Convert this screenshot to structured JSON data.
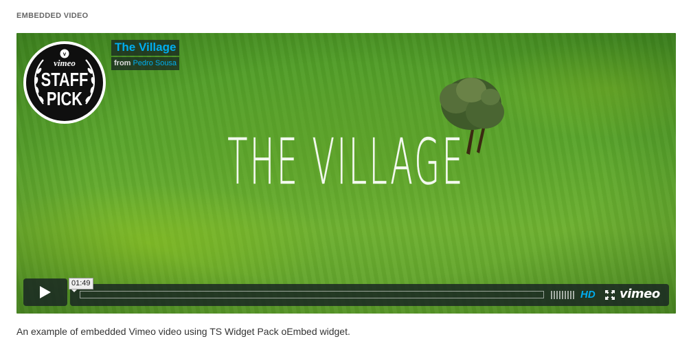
{
  "section": {
    "label": "EMBEDDED VIDEO"
  },
  "badge": {
    "brand": "vimeo",
    "line1": "STAFF",
    "line2": "PICK"
  },
  "video": {
    "title": "The Village",
    "from_label": "from",
    "author": "Pedro Sousa",
    "overlay_text": "THE VILLAGE"
  },
  "controls": {
    "time_tooltip": "01:49",
    "hd_label": "HD",
    "logo_text": "vimeo",
    "icons": [
      "play-icon",
      "volume-icon",
      "fullscreen-icon",
      "vimeo-logo"
    ]
  },
  "caption": "An example of embedded Vimeo video using TS Widget Pack oEmbed widget.",
  "colors": {
    "accent": "#00adef",
    "overlay_bg": "#172322",
    "grass": "#5aa52c"
  }
}
